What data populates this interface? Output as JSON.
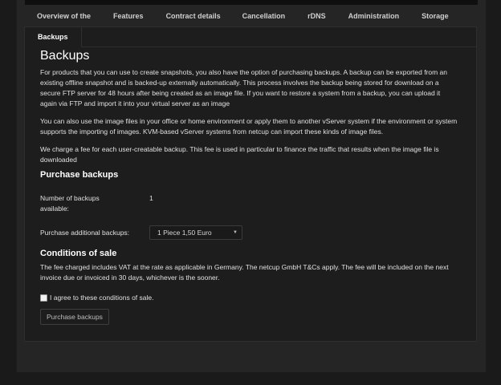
{
  "nav": {
    "tabs": [
      {
        "label": "Overview of the"
      },
      {
        "label": "Features"
      },
      {
        "label": "Contract details"
      },
      {
        "label": "Cancellation"
      },
      {
        "label": "rDNS"
      },
      {
        "label": "Administration"
      },
      {
        "label": "Storage"
      }
    ]
  },
  "subtab": {
    "label": "Backups"
  },
  "main": {
    "title": "Backups",
    "paragraphs": [
      "For products that you can use to create snapshots, you also have the option of purchasing backups. A backup can be exported from an existing offline snapshot and is backed-up externally automatically. This process involves the backup being stored for download on a secure FTP server for 48 hours after being created as an image file. If you want to restore a system from a backup, you can upload it again via FTP and import it into your virtual server as an image",
      "You can also use the image files in your office or home environment or apply them to another vServer system if the environment or system supports the importing of images. KVM-based vServer systems from netcup can import these kinds of image files.",
      "We charge a fee for each user-creatable backup. This fee is used in particular to finance the traffic that results when the image file is downloaded"
    ]
  },
  "purchase": {
    "heading": "Purchase backups",
    "available_label": "Number of backups available:",
    "available_value": "1",
    "additional_label": "Purchase additional backups:",
    "select_value": "1 Piece 1,50 Euro"
  },
  "conditions": {
    "heading": "Conditions of sale",
    "text": "The fee charged includes VAT at the rate as applicable in Germany. The netcup GmbH T&Cs apply. The fee will be included on the next invoice due or invoiced in 30 days, whichever is the sooner.",
    "agree_label": "I agree to these conditions of sale.",
    "button_label": "Purchase backups"
  }
}
